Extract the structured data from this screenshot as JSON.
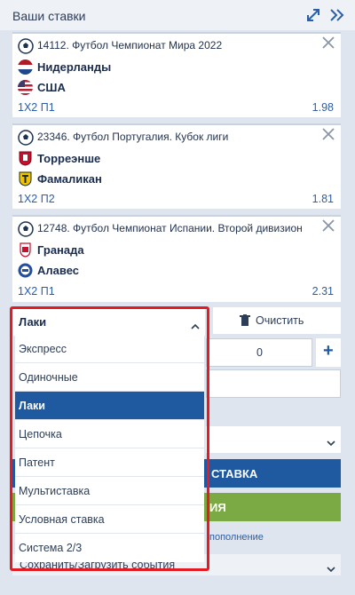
{
  "header": {
    "title": "Ваши ставки"
  },
  "bets": [
    {
      "event": "14112. Футбол Чемпионат Мира 2022",
      "team1": "Нидерланды",
      "team2": "США",
      "market": "1Х2 П1",
      "odds": "1.98"
    },
    {
      "event": "23346. Футбол Португалия. Кубок лиги",
      "team1": "Торреэнше",
      "team2": "Фамаликан",
      "market": "1Х2 П2",
      "odds": "1.81"
    },
    {
      "event": "12748. Футбол Чемпионат Испании. Второй дивизион",
      "team1": "Гранада",
      "team2": "Алавес",
      "market": "1Х2 П1",
      "odds": "2.31"
    }
  ],
  "bet_type": {
    "selected": "Лаки",
    "options": [
      "Экспресс",
      "Одиночные",
      "Лаки",
      "Цепочка",
      "Патент",
      "Мультиставка",
      "Условная ставка",
      "Система 2/3"
    ]
  },
  "clear_label": "Очистить",
  "stake_value": "0",
  "plus_label": "+",
  "place_bet_label": "СТАВКА",
  "green_btn_label": "ИЯ",
  "deposit_link": "пополнение",
  "save_load_label": "Сохранить/Загрузить события",
  "colors": {
    "accent_blue": "#1f5aa1",
    "green": "#7ba944",
    "red_highlight": "#e51b23"
  }
}
